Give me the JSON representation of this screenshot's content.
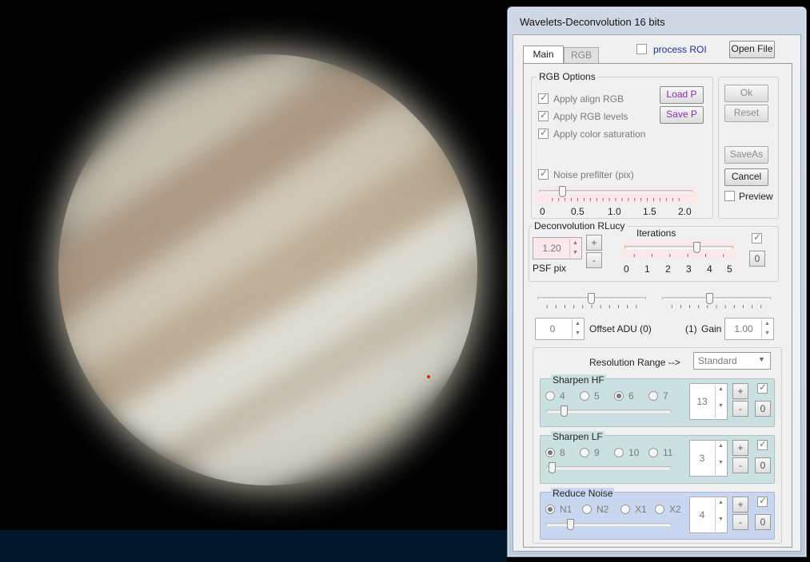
{
  "window": {
    "title": "Wavelets-Deconvolution 16 bits"
  },
  "header": {
    "process_roi_label": "process ROI",
    "process_roi_checked": false,
    "open_file_label": "Open File"
  },
  "tabs": [
    {
      "label": "Main",
      "active": true
    },
    {
      "label": "RGB",
      "active": false
    }
  ],
  "rgb_options": {
    "title": "RGB Options",
    "apply_align_rgb": "Apply align RGB",
    "apply_rgb_levels": "Apply RGB levels",
    "apply_color_saturation": "Apply color saturation",
    "load_p": "Load P",
    "save_p": "Save P",
    "noise_prefilter": "Noise prefilter (pix)",
    "scale": [
      "0",
      "0.5",
      "1.0",
      "1.5",
      "2.0"
    ],
    "noise_prefilter_value": 0.3
  },
  "actions": {
    "ok": "Ok",
    "reset": "Reset",
    "save_as": "SaveAs",
    "cancel": "Cancel",
    "preview": "Preview",
    "preview_checked": false
  },
  "deconvolution": {
    "title": "Deconvolution RLucy",
    "psf_value": "1.20",
    "psf_label": "PSF pix",
    "plus": "+",
    "minus": "-",
    "iterations_label": "Iterations",
    "iterations_scale": [
      "0",
      "1",
      "2",
      "3",
      "4",
      "5"
    ],
    "iterations_value": 3.3,
    "zero_button": "0"
  },
  "offset_gain": {
    "offset_value": "0",
    "offset_label": "Offset ADU (0)",
    "gain_prefix": "(1)",
    "gain_label": "Gain",
    "gain_value": "1.00"
  },
  "resolution": {
    "label": "Resolution Range  -->",
    "selected": "Standard"
  },
  "sharpen_hf": {
    "title": "Sharpen HF",
    "options": [
      "4",
      "5",
      "6",
      "7"
    ],
    "selected_index": 2,
    "value": "13",
    "plus": "+",
    "minus": "-",
    "zero": "0"
  },
  "sharpen_lf": {
    "title": "Sharpen LF",
    "options": [
      "8",
      "9",
      "10",
      "11"
    ],
    "selected_index": 0,
    "value": "3",
    "plus": "+",
    "minus": "-",
    "zero": "0"
  },
  "reduce_noise": {
    "title": "Reduce Noise",
    "options": [
      "N1",
      "N2",
      "X1",
      "X2"
    ],
    "selected_index": 0,
    "value": "4",
    "plus": "+",
    "minus": "-",
    "zero": "0"
  },
  "colors": {
    "titlebar": "#cfd9e6",
    "panel": "#f0f0f0",
    "teal": "#cbe0e0",
    "blue": "#c8d7ef",
    "purple": "#8a2bb5",
    "psf_bg": "#fbe8e8"
  }
}
